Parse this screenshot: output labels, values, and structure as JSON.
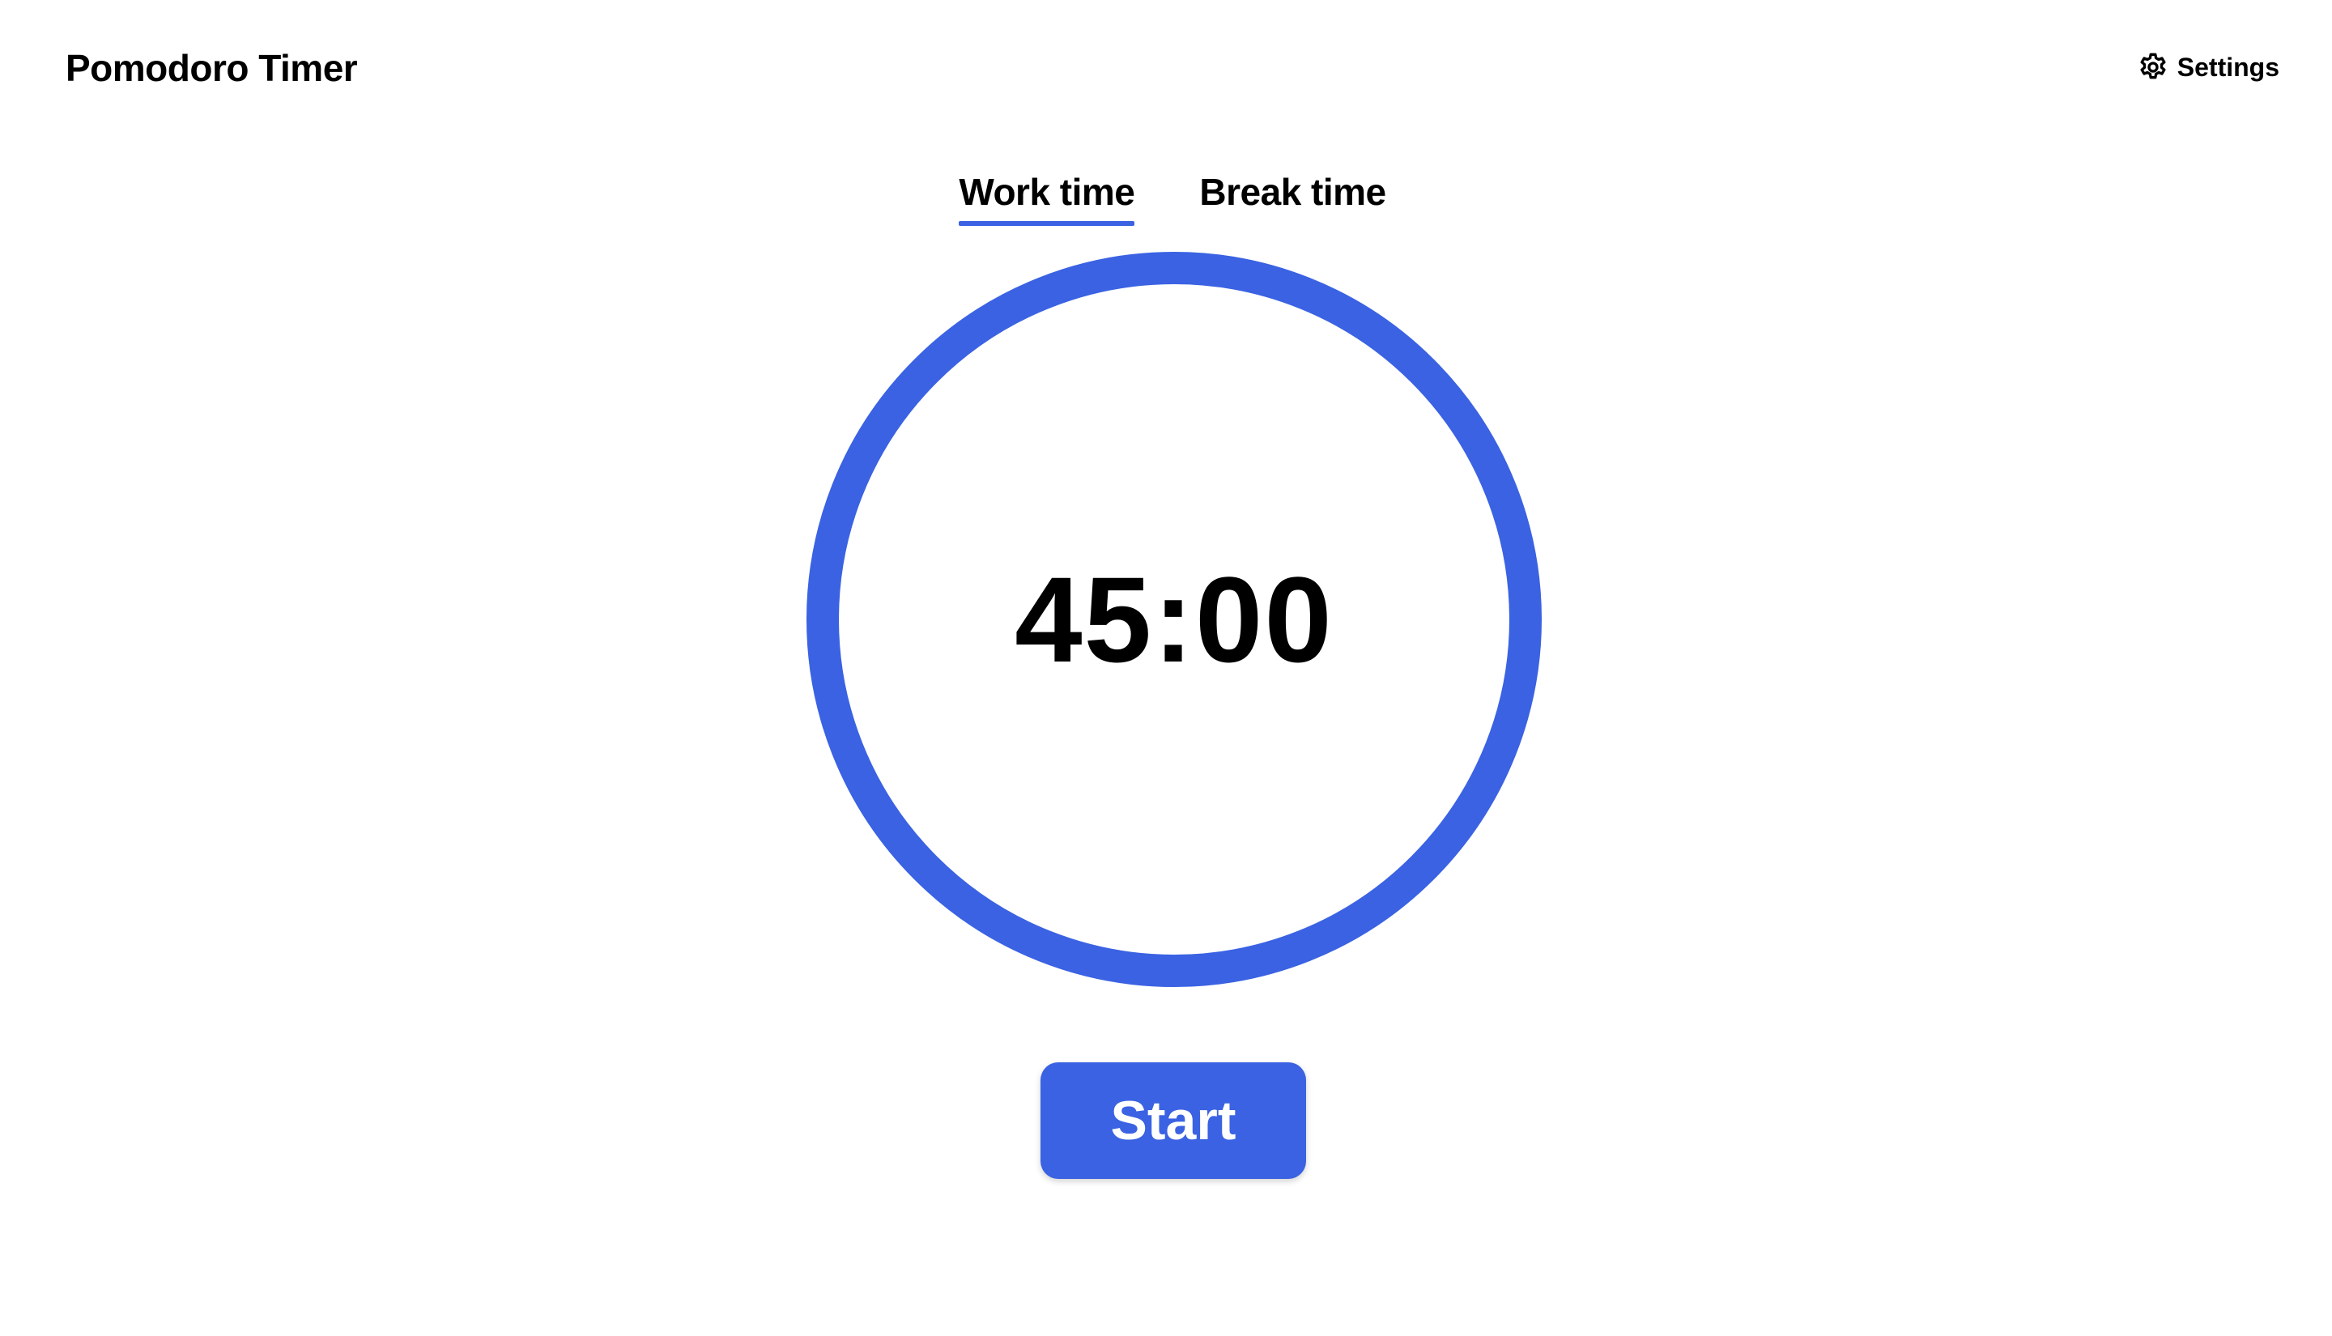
{
  "app": {
    "title": "Pomodoro Timer"
  },
  "header": {
    "settings_label": "Settings",
    "settings_icon": "gear-icon"
  },
  "tabs": [
    {
      "label": "Work time",
      "active": true
    },
    {
      "label": "Break time",
      "active": false
    }
  ],
  "timer": {
    "display": "45:00",
    "progress_fraction": 1.0
  },
  "controls": {
    "start_label": "Start"
  },
  "colors": {
    "accent": "#3A62E2",
    "text": "#000000",
    "background": "#FFFFFF"
  }
}
